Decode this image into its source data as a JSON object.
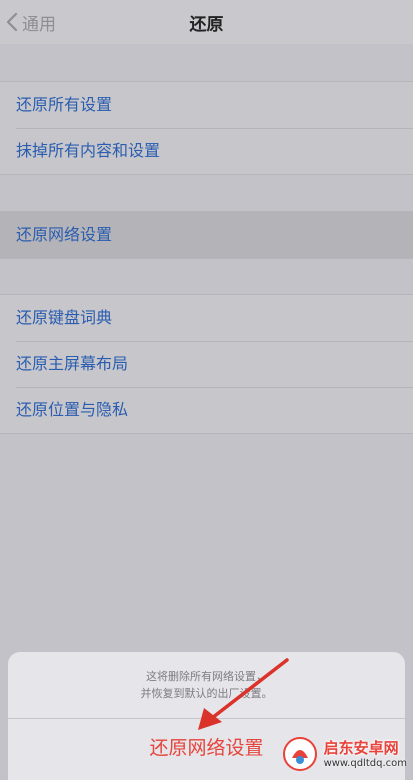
{
  "navbar": {
    "back_label": "通用",
    "title": "还原"
  },
  "groups": [
    {
      "items": [
        "还原所有设置",
        "抹掉所有内容和设置"
      ]
    },
    {
      "items": [
        "还原网络设置"
      ]
    },
    {
      "items": [
        "还原键盘词典",
        "还原主屏幕布局",
        "还原位置与隐私"
      ]
    }
  ],
  "action_sheet": {
    "message_line1": "这将删除所有网络设置，",
    "message_line2": "并恢复到默认的出厂设置。",
    "action_label": "还原网络设置"
  },
  "watermark": {
    "name": "启东安卓网",
    "url": "www.qdltdq.com"
  },
  "colors": {
    "link": "#2a5db0",
    "destructive": "#e5453c",
    "arrow": "#d9332a"
  }
}
